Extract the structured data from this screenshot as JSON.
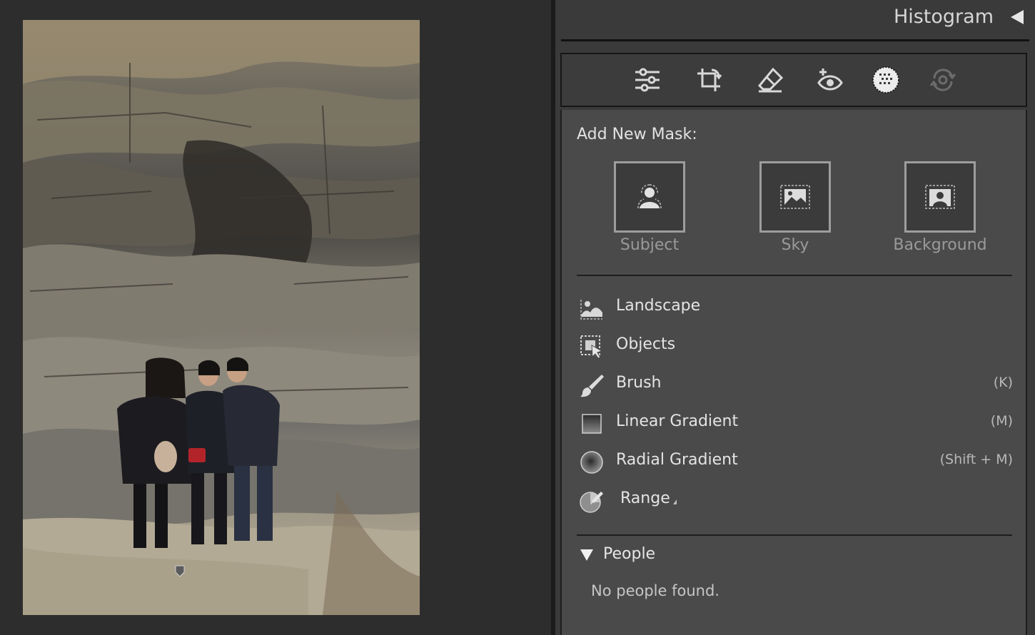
{
  "panel": {
    "histogram_title": "Histogram"
  },
  "toolstrip": {
    "tools": [
      {
        "name": "edit-sliders-icon"
      },
      {
        "name": "crop-icon"
      },
      {
        "name": "healing-eraser-icon"
      },
      {
        "name": "red-eye-icon"
      },
      {
        "name": "masking-icon",
        "active": true
      },
      {
        "name": "presets-reset-icon",
        "disabled": true
      }
    ]
  },
  "mask_panel": {
    "heading": "Add New Mask:",
    "quick_masks": [
      {
        "label": "Subject",
        "icon": "subject-mask-icon"
      },
      {
        "label": "Sky",
        "icon": "sky-mask-icon"
      },
      {
        "label": "Background",
        "icon": "background-mask-icon"
      }
    ],
    "items": [
      {
        "label": "Landscape",
        "shortcut": "",
        "icon": "landscape-icon"
      },
      {
        "label": "Objects",
        "shortcut": "",
        "icon": "objects-icon"
      },
      {
        "label": "Brush",
        "shortcut": "(K)",
        "icon": "brush-icon"
      },
      {
        "label": "Linear Gradient",
        "shortcut": "(M)",
        "icon": "linear-gradient-icon"
      },
      {
        "label": "Radial Gradient",
        "shortcut": "(Shift + M)",
        "icon": "radial-gradient-icon"
      },
      {
        "label": "Range",
        "shortcut": "",
        "icon": "range-icon"
      }
    ],
    "people": {
      "title": "People",
      "empty_text": "No people found."
    }
  },
  "colors": {
    "panel_bg": "#4a4a4a",
    "app_bg": "#2b2b2b",
    "toolstrip_bg": "#3c3c3c"
  }
}
